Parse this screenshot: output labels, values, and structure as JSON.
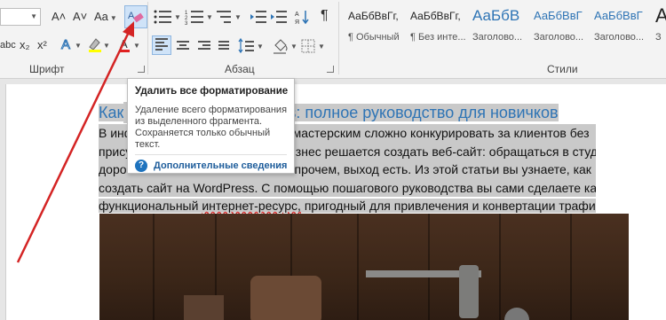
{
  "ribbon": {
    "font_group": {
      "label": "Шрифт",
      "grow_font": "A˄",
      "shrink_font": "A˅",
      "change_case": "Aa",
      "strikethrough": "abc",
      "subscript": "x₂",
      "superscript": "x²"
    },
    "paragraph_group": {
      "label": "Абзац"
    },
    "styles_group": {
      "label": "Стили",
      "items": [
        {
          "sample": "АаБбВвГг,",
          "name": "¶ Обычный"
        },
        {
          "sample": "АаБбВвГг,",
          "name": "¶ Без инте..."
        },
        {
          "sample": "АаБбВ",
          "name": "Заголово..."
        },
        {
          "sample": "АаБбВвГ",
          "name": "Заголово..."
        },
        {
          "sample": "АаБбВвГ",
          "name": "Заголово..."
        },
        {
          "sample": "А",
          "name": "З"
        }
      ]
    }
  },
  "tooltip": {
    "title": "Удалить все форматирование",
    "body": "Удаление всего форматирования из выделенного фрагмента. Сохраняется только обычный текст.",
    "help_link": "Дополнительные сведения"
  },
  "document": {
    "title": "Как ... WordPress: полное руководство для новичков",
    "title_visible_left": "Как",
    "title_visible_right": "Press: полное руководство для новичков",
    "lines": [
      {
        "left": "В инф",
        "right": "ным мастерским сложно конкурировать за клиентов без"
      },
      {
        "left": "прису",
        "right": "ый бизнес решается создать веб-сайт: обращаться в студию"
      },
      {
        "left": "доро",
        "right": "жно. Впрочем, выход есть. Из этой статьи вы узнаете, как"
      },
      {
        "left": "создать сайт на WordPress. С помощью пошагового руководства вы сами сделаете качественный и",
        "right": ""
      },
      {
        "left": "функциональный ",
        "right": " пригодный для привлечения и конвертации трафика."
      }
    ],
    "misspelled_word": "интернет-ресурс,"
  },
  "colors": {
    "accent": "#2e74b5",
    "annotation_arrow": "#d42424",
    "selection": "#c9c9c9"
  }
}
